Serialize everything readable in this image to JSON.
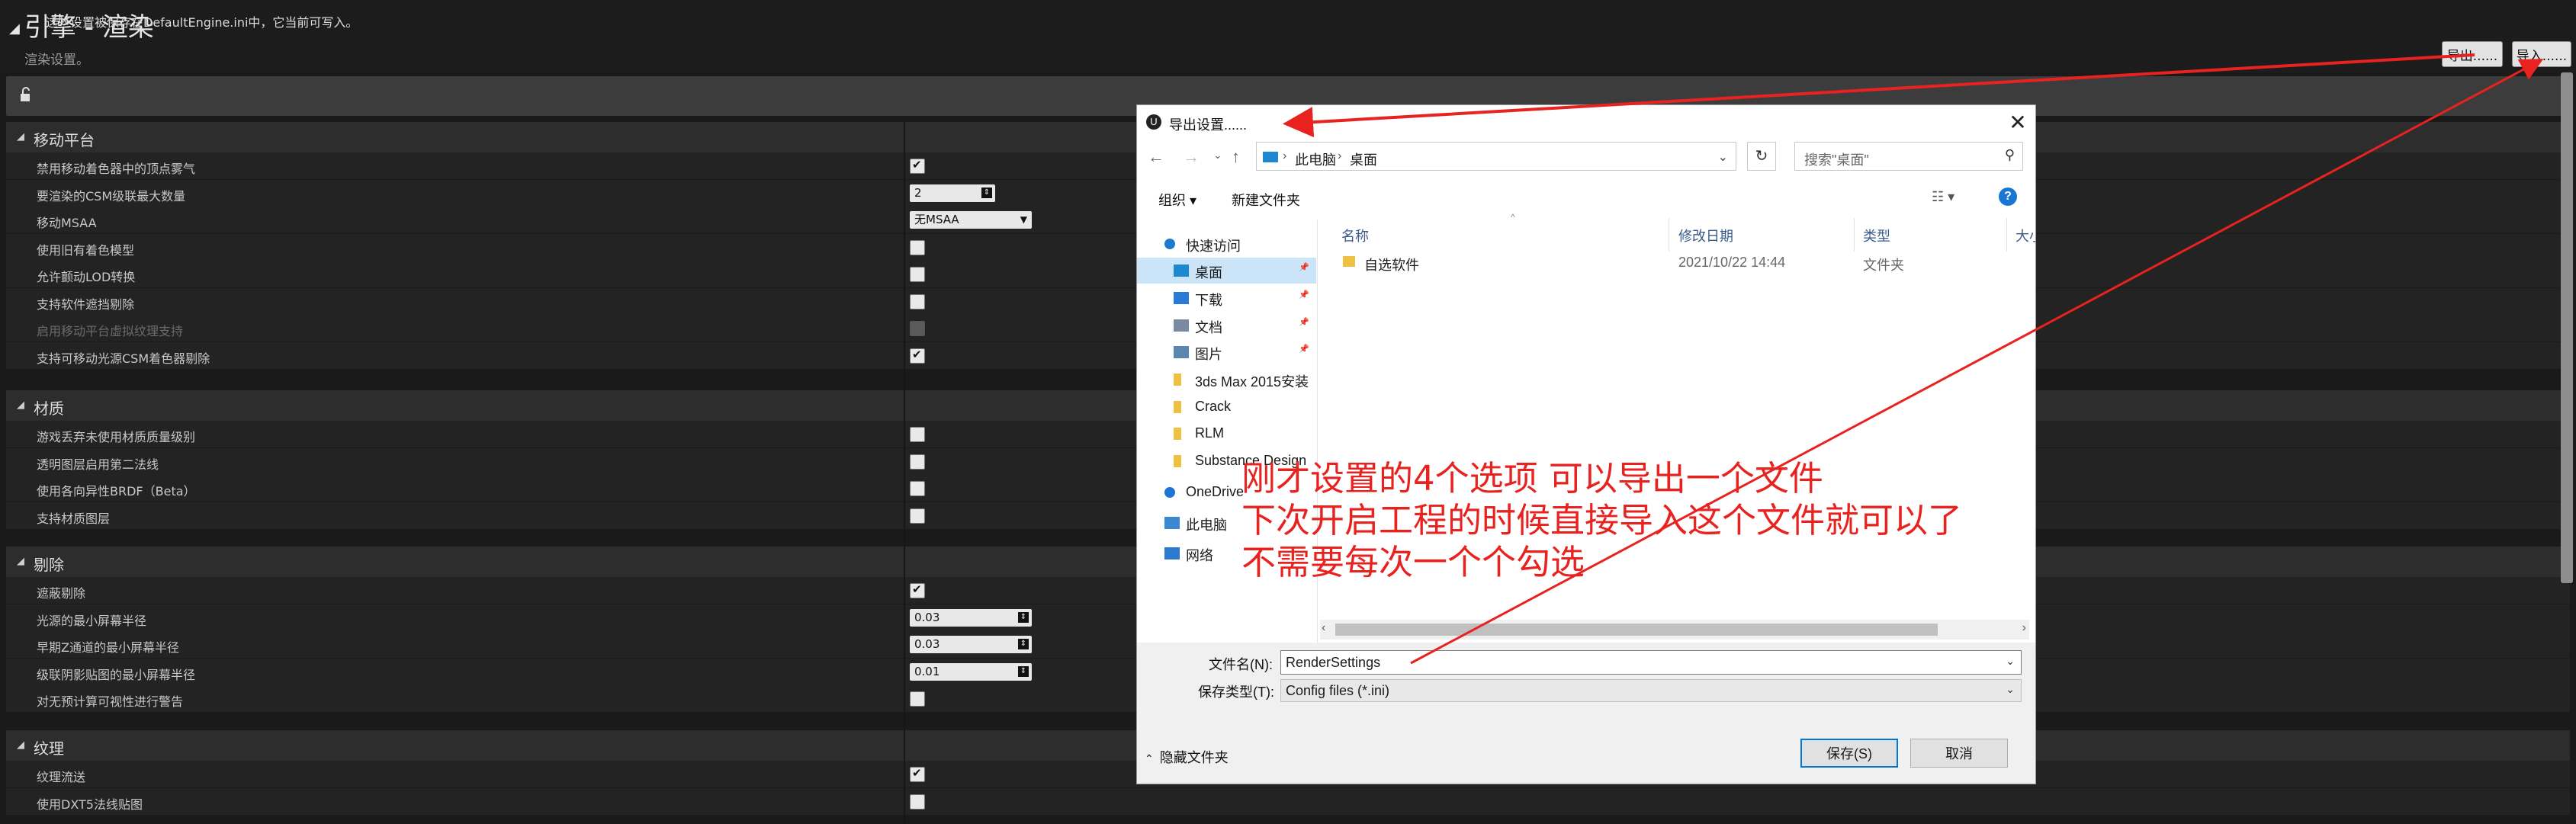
{
  "header": {
    "title": "引擎 - 渲染",
    "subtitle": "渲染设置。",
    "export_label": "导出......",
    "import_label": "导入......",
    "info": "这些设置被保存在DefaultEngine.ini中，它当前可写入。"
  },
  "categories": [
    {
      "label": "移动平台"
    },
    {
      "label": "材质"
    },
    {
      "label": "剔除"
    },
    {
      "label": "纹理"
    }
  ],
  "rows": {
    "mobile": [
      {
        "label": "禁用移动着色器中的顶点雾气",
        "checked": true
      },
      {
        "label": "要渲染的CSM级联最大数量",
        "value": "2"
      },
      {
        "label": "移动MSAA",
        "value": "无MSAA"
      },
      {
        "label": "使用旧有着色模型",
        "checked": false
      },
      {
        "label": "允许颤动LOD转换",
        "checked": false
      },
      {
        "label": "支持软件遮挡剔除",
        "checked": false
      },
      {
        "label": "启用移动平台虚拟纹理支持",
        "checked": false,
        "disabled": true
      },
      {
        "label": "支持可移动光源CSM着色器剔除",
        "checked": true
      }
    ],
    "material": [
      {
        "label": "游戏丢弃未使用材质质量级别",
        "checked": false
      },
      {
        "label": "透明图层启用第二法线",
        "checked": false
      },
      {
        "label": "使用各向异性BRDF（Beta）",
        "checked": false
      },
      {
        "label": "支持材质图层",
        "checked": false
      }
    ],
    "culling": [
      {
        "label": "遮蔽剔除",
        "checked": true
      },
      {
        "label": "光源的最小屏幕半径",
        "value": "0.03"
      },
      {
        "label": "早期Z通道的最小屏幕半径",
        "value": "0.03"
      },
      {
        "label": "级联阴影贴图的最小屏幕半径",
        "value": "0.01"
      },
      {
        "label": "对无预计算可视性进行警告",
        "checked": false
      }
    ],
    "texture": [
      {
        "label": "纹理流送",
        "checked": true
      },
      {
        "label": "使用DXT5法线贴图",
        "checked": false
      }
    ]
  },
  "dialog": {
    "title": "导出设置......",
    "address": {
      "root": "此电脑",
      "current": "桌面"
    },
    "search_placeholder": "搜索\"桌面\"",
    "organize": "组织 ▾",
    "new_folder": "新建文件夹",
    "nav": [
      {
        "label": "快速访问",
        "icon": "star-icon"
      },
      {
        "label": "桌面",
        "icon": "desktop-icon",
        "pinned": true,
        "selected": true
      },
      {
        "label": "下载",
        "icon": "download-icon",
        "pinned": true
      },
      {
        "label": "文档",
        "icon": "document-icon",
        "pinned": true
      },
      {
        "label": "图片",
        "icon": "picture-icon",
        "pinned": true
      },
      {
        "label": "3ds Max 2015安装",
        "icon": "folder-icon"
      },
      {
        "label": "Crack",
        "icon": "folder-icon"
      },
      {
        "label": "RLM",
        "icon": "folder-icon"
      },
      {
        "label": "Substance Design",
        "icon": "folder-icon"
      },
      {
        "label": "OneDrive",
        "icon": "cloud-icon"
      },
      {
        "label": "此电脑",
        "icon": "pc-icon"
      },
      {
        "label": "网络",
        "icon": "network-icon"
      }
    ],
    "columns": [
      "名称",
      "修改日期",
      "类型",
      "大小"
    ],
    "files": [
      {
        "name": "自选软件",
        "date": "2021/10/22 14:44",
        "type": "文件夹"
      }
    ],
    "filename_label": "文件名(N):",
    "filename": "RenderSettings",
    "filetype_label": "保存类型(T):",
    "filetype": "Config files (*.ini)",
    "hide_folders": "隐藏文件夹",
    "save": "保存(S)",
    "cancel": "取消"
  },
  "annotation": {
    "line1": "刚才设置的4个选项 可以导出一个文件",
    "line2": "下次开启工程的时候直接导入这个文件就可以了",
    "line3": "不需要每次一个个勾选"
  },
  "colors": {
    "annotation": "#e8221f",
    "accent": "#0078d7"
  }
}
